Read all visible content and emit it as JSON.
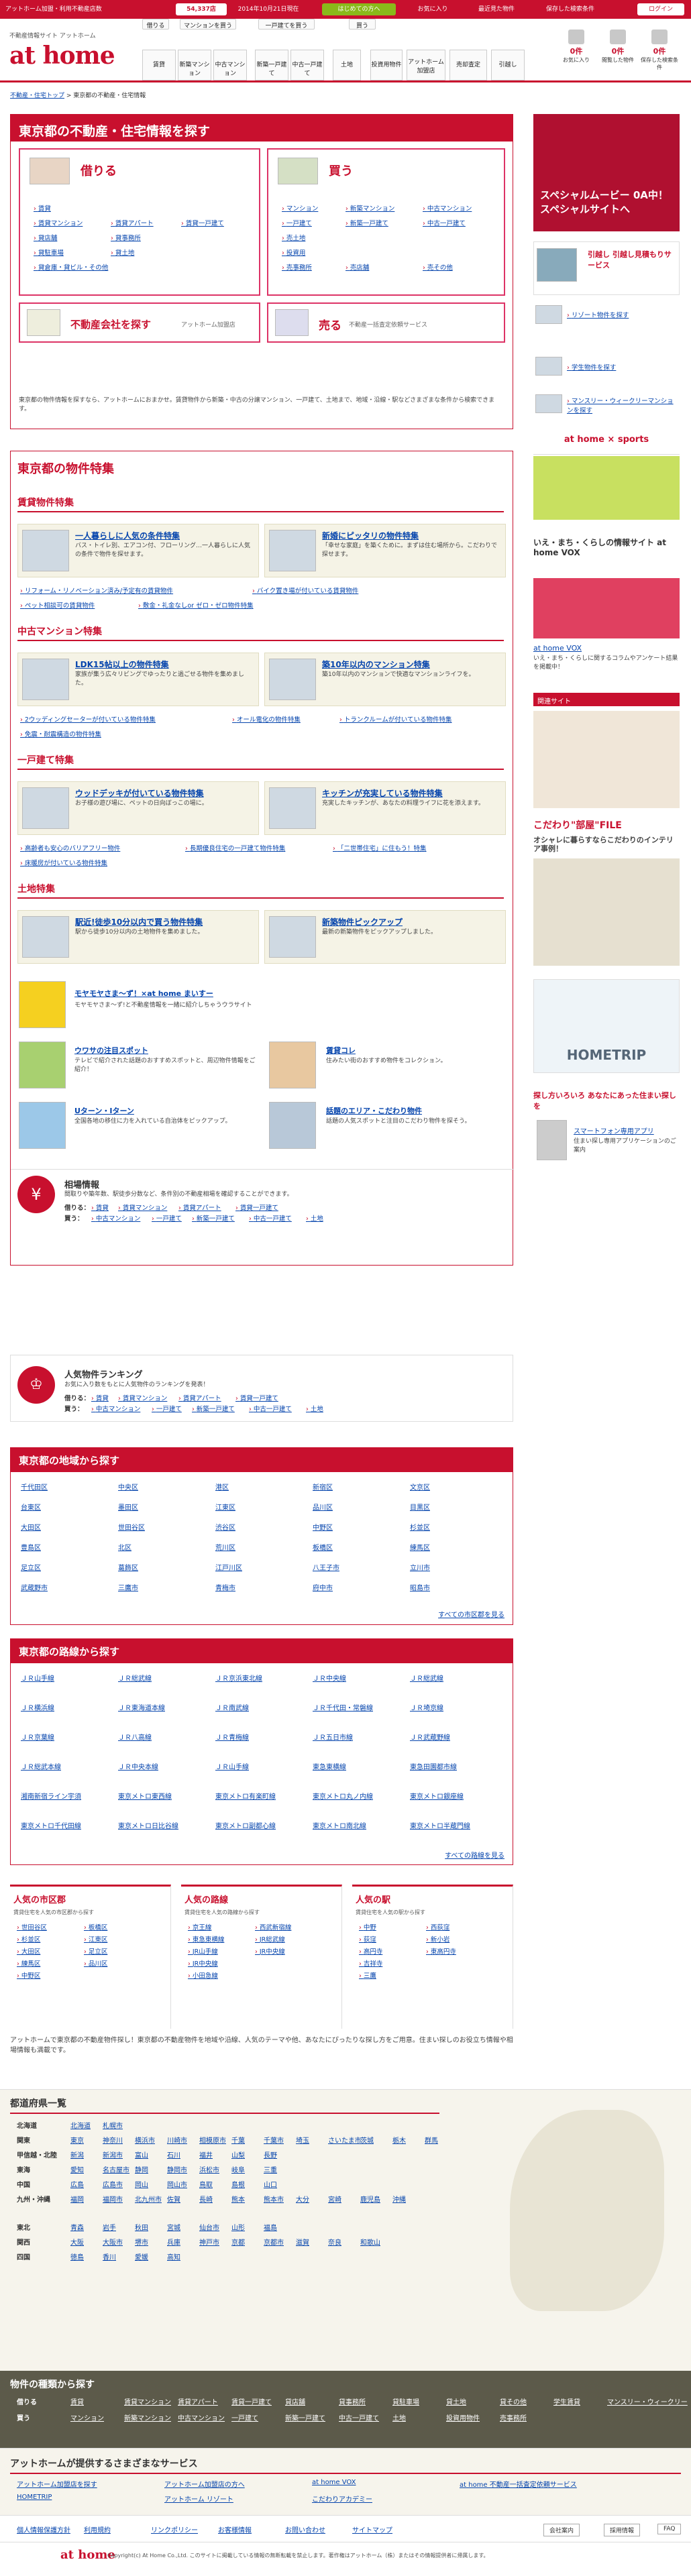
{
  "topbar": {
    "label1": "不動産情報サイト アットホーム",
    "brand_count_label": "アットホーム加盟・利用不動産店数",
    "count": "54,337店",
    "date": "2014年10月21日現在",
    "btn1": "はじめての方へ",
    "btn2": "お気に入り",
    "btn3": "最近見た物件",
    "btn4": "保存した検索条件",
    "login": "ログイン"
  },
  "header": {
    "tagline": "不動産情報サイト アットホーム",
    "logo": "at home",
    "nav_top": [
      "借りる",
      "マンションを買う",
      "一戸建てを買う",
      "買う"
    ],
    "nav": [
      "賃貸",
      "新築マンション",
      "中古マンション",
      "新築一戸建て",
      "中古一戸建て",
      "土地",
      "投資用物件",
      "アットホーム加盟店",
      "売却査定",
      "引越し"
    ],
    "icons": [
      {
        "label": "お気に入り",
        "count": "0件"
      },
      {
        "label": "閲覧した物件",
        "count": "0件"
      },
      {
        "label": "保存した検索条件",
        "count": "0件"
      }
    ]
  },
  "breadcrumb": [
    "不動産・住宅トップ",
    "東京都の不動産・住宅情報"
  ],
  "main": {
    "title": "東京都の不動産・住宅情報を探す",
    "rent": {
      "label": "借りる",
      "links": [
        "賃貸",
        "賃貸マンション",
        "賃貸アパート",
        "賃貸一戸建て",
        "貸店舗",
        "貸事務所",
        "貸駐車場",
        "貸土地",
        "貸倉庫・貸ビル・その他"
      ]
    },
    "buy": {
      "label": "買う",
      "links": [
        "マンション",
        "新築マンション",
        "中古マンション",
        "一戸建て",
        "新築一戸建て",
        "中古一戸建て",
        "売土地",
        "投資用",
        "売事務所",
        "売店舗",
        "売その他"
      ]
    },
    "agent": {
      "label": "不動産会社を探す",
      "sub": "アットホーム加盟店"
    },
    "sell": {
      "label": "売る",
      "sub": "不動産一括査定依頼サービス"
    },
    "intro": "東京都の物件情報を探すなら、アットホームにおまかせ。賃貸物件から新築・中古の分譲マンション、一戸建て、土地まで、地域・沿線・駅などさまざまな条件から検索できます。",
    "feature_title": "東京都の物件特集",
    "rent_feat": {
      "label": "賃貸物件特集",
      "c1t": "一人暮らしに人気の条件特集",
      "c1x": "バス・トイレ別、エアコン付、フローリング…一人暮らしに人気の条件で物件を探せます。",
      "c2t": "新婚にピッタリの物件特集",
      "c2x": "「幸せな家庭」を築くために。まずは住む場所から。こだわりで探せます。",
      "l": [
        "リフォーム・リノベーション済み/予定有の賃貸物件",
        "バイク置き場が付いている賃貸物件",
        "ペット相談可の賃貸物件",
        "敷金・礼金なしor ゼロ・ゼロ物件特集"
      ]
    },
    "mansion_feat": {
      "label": "中古マンション特集",
      "c1t": "LDK15帖以上の物件特集",
      "c1x": "家族が集う広々リビングでゆったりと過ごせる物件を集めました。",
      "c2t": "築10年以内のマンション特集",
      "c2x": "築10年以内のマンションで快適なマンションライフを。",
      "l": [
        "2ウッディングセーターが付いている物件特集",
        "オール電化の物件特集",
        "トランクルームが付いている物件特集",
        "免震・耐震構造の物件特集"
      ]
    },
    "house_feat": {
      "label": "一戸建て特集",
      "c1t": "ウッドデッキが付いている物件特集",
      "c1x": "お子様の遊び場に、ペットの日向ぼっこの場に。",
      "c2t": "キッチンが充実している物件特集",
      "c2x": "充実したキッチンが、あなたの料理ライフに花を添えます。",
      "l": [
        "高齢者も安心のバリアフリー物件",
        "長期優良住宅の一戸建て物件特集",
        "「二世帯住宅」に住もう！特集",
        "床暖房が付いている物件特集"
      ]
    },
    "land_feat": {
      "label": "土地特集",
      "c1t": "駅近!徒歩10分以内で買う物件特集",
      "c1x": "駅から徒歩10分以内の土地物件を集めました。",
      "c2t": "新築物件ピックアップ",
      "c2x": "最新の新築物件をピックアップしました。"
    },
    "extra": [
      {
        "t": "モヤモヤさま〜ず！×at home まいすー",
        "x": "モヤモヤさま〜ず!と不動産情報を一緒に紹介しちゃうウラサイト"
      },
      {
        "t": "ウワサの注目スポット",
        "x": "テレビで紹介された話題のおすすめスポットと、周辺物件情報をご紹介！"
      },
      {
        "t": "賃貸コレ",
        "x": "住みたい街のおすすめ物件をコレクション。"
      },
      {
        "t": "Uターン・Iターン",
        "x": "全国各地の移住に力を入れている自治体をピックアップ。"
      },
      {
        "t": "話題のエリア・こだわり物件",
        "x": "話題の人気スポットと注目のこだわり物件を探そう。"
      }
    ],
    "price": {
      "t": "相場情報",
      "x": "間取りや築年数、駅徒歩分数など、条件別の不動産相場を確認することができます。",
      "rent_l": [
        "賃貸",
        "賃貸マンション",
        "賃貸アパート",
        "賃貸一戸建て"
      ],
      "buy_l": [
        "中古マンション",
        "一戸建て",
        "新築一戸建て",
        "中古一戸建て",
        "土地"
      ]
    },
    "rank": {
      "t": "人気物件ランキング",
      "x": "お気に入り数をもとに人気物件のランキングを発表！",
      "rent_l": [
        "賃貸",
        "賃貸マンション",
        "賃貸アパート",
        "賃貸一戸建て"
      ],
      "buy_l": [
        "中古マンション",
        "一戸建て",
        "新築一戸建て",
        "中古一戸建て",
        "土地"
      ]
    },
    "area_title": "東京都の地域から探す",
    "areas": [
      "千代田区",
      "中央区",
      "港区",
      "新宿区",
      "文京区",
      "台東区",
      "墨田区",
      "江東区",
      "品川区",
      "目黒区",
      "大田区",
      "世田谷区",
      "渋谷区",
      "中野区",
      "杉並区",
      "豊島区",
      "北区",
      "荒川区",
      "板橋区",
      "練馬区",
      "足立区",
      "葛飾区",
      "江戸川区",
      "八王子市",
      "立川市",
      "武蔵野市",
      "三鷹市",
      "青梅市",
      "府中市",
      "昭島市"
    ],
    "area_more": "すべての市区郡を見る",
    "line_title": "東京都の路線から探す",
    "lines": [
      "ＪＲ山手線",
      "ＪＲ総武線",
      "ＪＲ京浜東北線",
      "ＪＲ中央線",
      "ＪＲ総武線",
      "ＪＲ横浜線",
      "ＪＲ東海道本線",
      "ＪＲ南武線",
      "ＪＲ千代田・常磐線",
      "ＪＲ埼京線",
      "ＪＲ京葉線",
      "ＪＲ八高線",
      "ＪＲ青梅線",
      "ＪＲ五日市線",
      "ＪＲ武蔵野線",
      "ＪＲ総武本線",
      "ＪＲ中央本線",
      "ＪＲ山手線",
      "東急東横線",
      "東急田園都市線",
      "湘南新宿ライン宇須",
      "東京メトロ東西線",
      "東京メトロ有楽町線",
      "東京メトロ丸ノ内線",
      "東京メトロ銀座線",
      "東京メトロ千代田線",
      "東京メトロ日比谷線",
      "東京メトロ副都心線",
      "東京メトロ南北線",
      "東京メトロ半蔵門線"
    ],
    "line_more": "すべての路線を見る",
    "pop": [
      {
        "t": "人気の市区郡",
        "sub": "賃貸住宅を人気の市区郡から探す",
        "l": [
          "世田谷区",
          "杉並区",
          "大田区",
          "練馬区",
          "中野区",
          "板橋区",
          "江東区",
          "足立区",
          "品川区"
        ]
      },
      {
        "t": "人気の路線",
        "sub": "賃貸住宅を人気の路線から探す",
        "l": [
          "京王線",
          "東急東横線",
          "JR山手線",
          "JR中央線",
          "小田急線",
          "西武新宿線",
          "JR総武線",
          "JR中央線"
        ]
      },
      {
        "t": "人気の駅",
        "sub": "賃貸住宅を人気の駅から探す",
        "l": [
          "中野",
          "荻窪",
          "高円寺",
          "吉祥寺",
          "三鷹",
          "西荻窪",
          "新小岩",
          "東高円寺"
        ]
      }
    ],
    "outro": "アットホームで東京都の不動産物件探し！東京都の不動産物件を地域や沿線、人気のテーマや他、あなたにぴったりな探し方をご用意。住まい探しのお役立ち情報や相場情報も満載です。"
  },
  "sidebar": {
    "ad1": "スペシャルムービー 0A中！ スペシャルサイトへ",
    "move": "引越し 引越し見積もりサービス",
    "link1": "リゾート物件を探す",
    "link2": "学生物件を探す",
    "link3": "マンスリー・ウィークリーマンションを探す",
    "sports": "at home × sports",
    "vox_t": "いえ・まち・くらしの情報サイト at home VOX",
    "vox_l": "at home VOX",
    "vox_x": "いえ・まち・くらしに関するコラムやアンケート結果を掲載中！",
    "rel": "関連サイト",
    "file": "こだわり\"部屋\"FILE",
    "file_x": "オシャレに暮らすならこだわりのインテリア事例！",
    "trip": "HOMETRIP",
    "app_t": "探し方いろいろ あなたにあった住まい探しを",
    "app_l": "スマートフォン専用アプリ",
    "app_x": "住まい探し専用アプリケーションのご案内"
  },
  "footer": {
    "pref_title": "都道府県一覧",
    "regions": [
      {
        "r": "北海道",
        "p": [
          "北海道",
          "札幌市"
        ]
      },
      {
        "r": "関東",
        "p": [
          "東京",
          "神奈川",
          "横浜市",
          "川崎市",
          "相模原市",
          "千葉",
          "千葉市",
          "埼玉",
          "さいたま市",
          "茨城",
          "栃木",
          "群馬"
        ]
      },
      {
        "r": "甲信越・北陸",
        "p": [
          "新潟",
          "新潟市",
          "富山",
          "石川",
          "福井",
          "山梨",
          "長野"
        ]
      },
      {
        "r": "東海",
        "p": [
          "愛知",
          "名古屋市",
          "静岡",
          "静岡市",
          "浜松市",
          "岐阜",
          "三重"
        ]
      },
      {
        "r": "中国",
        "p": [
          "広島",
          "広島市",
          "岡山",
          "岡山市",
          "鳥取",
          "島根",
          "山口"
        ]
      },
      {
        "r": "九州・沖縄",
        "p": [
          "福岡",
          "福岡市",
          "北九州市",
          "佐賀",
          "長崎",
          "熊本",
          "熊本市",
          "大分",
          "宮崎",
          "鹿児島",
          "沖縄"
        ]
      },
      {
        "r": "東北",
        "p": [
          "青森",
          "岩手",
          "秋田",
          "宮城",
          "仙台市",
          "山形",
          "福島"
        ]
      },
      {
        "r": "関西",
        "p": [
          "大阪",
          "大阪市",
          "堺市",
          "兵庫",
          "神戸市",
          "京都",
          "京都市",
          "滋賀",
          "奈良",
          "和歌山"
        ]
      },
      {
        "r": "四国",
        "p": [
          "徳島",
          "香川",
          "愛媛",
          "高知"
        ]
      }
    ],
    "kind_title": "物件の種類から探す",
    "kind_rent": [
      "賃貸",
      "賃貸マンション",
      "賃貸アパート",
      "賃貸一戸建て",
      "貸店舗",
      "貸事務所",
      "貸駐車場",
      "貸土地",
      "貸その他",
      "学生賃貸",
      "マンスリー・ウィークリー"
    ],
    "kind_buy": [
      "マンション",
      "新築マンション",
      "中古マンション",
      "一戸建て",
      "新築一戸建て",
      "中古一戸建て",
      "土地",
      "投資用物件",
      "売事務所"
    ],
    "svc_title": "アットホームが提供するさまざまなサービス",
    "svc": [
      "アットホーム加盟店を探す",
      "アットホーム加盟店の方へ",
      "at home VOX",
      "at home 不動産一括査定依頼サービス",
      "HOMETRIP",
      "アットホーム リゾート",
      "こだわりアカデミー"
    ],
    "bottom": [
      "個人情報保護方針",
      "利用規約",
      "リンクポリシー",
      "お客様情報",
      "お問い合わせ",
      "サイトマップ"
    ],
    "company": "会社案内",
    "recruit": "採用情報",
    "faq": "FAQ",
    "copy": "Copyright(c) At Home Co.,Ltd. このサイトに掲載している情報の無断転載を禁止します。著作権はアットホーム（株）またはその情報提供者に帰属します。",
    "logo": "at home"
  }
}
